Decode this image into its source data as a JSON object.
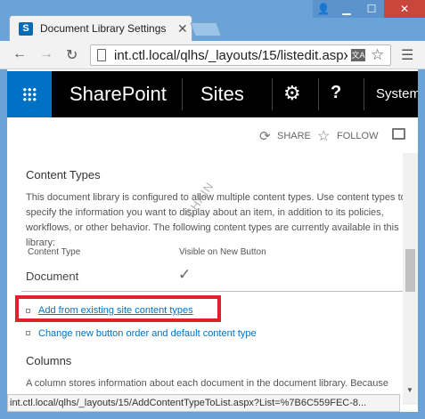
{
  "browser": {
    "tab_title": "Document Library Settings",
    "url": "int.ctl.local/qlhs/_layouts/15/listedit.aspx",
    "status_url": "int.ctl.local/qlhs/_layouts/15/AddContentTypeToList.aspx?List=%7B6C559FEC-8..."
  },
  "suitebar": {
    "brand": "SharePoint",
    "sites": "Sites",
    "user": "System"
  },
  "actions": {
    "share": "SHARE",
    "follow": "FOLLOW"
  },
  "content_types": {
    "heading": "Content Types",
    "description": "This document library is configured to allow multiple content types. Use content types to specify the information you want to display about an item, in addition to its policies, workflows, or other behavior. The following content types are currently available in this library:",
    "col_content_type": "Content Type",
    "col_visible": "Visible on New Button",
    "rows": [
      {
        "name": "Document",
        "visible": "✓"
      }
    ],
    "link_add": "Add from existing site content types",
    "link_order": "Change new button order and default content type"
  },
  "columns": {
    "heading": "Columns",
    "description": "A column stores information about each document in the document library. Because"
  },
  "watermark": "CHAIN",
  "colors": {
    "accent": "#0072c6",
    "suitebar": "#000000",
    "highlight": "#e0202b"
  }
}
